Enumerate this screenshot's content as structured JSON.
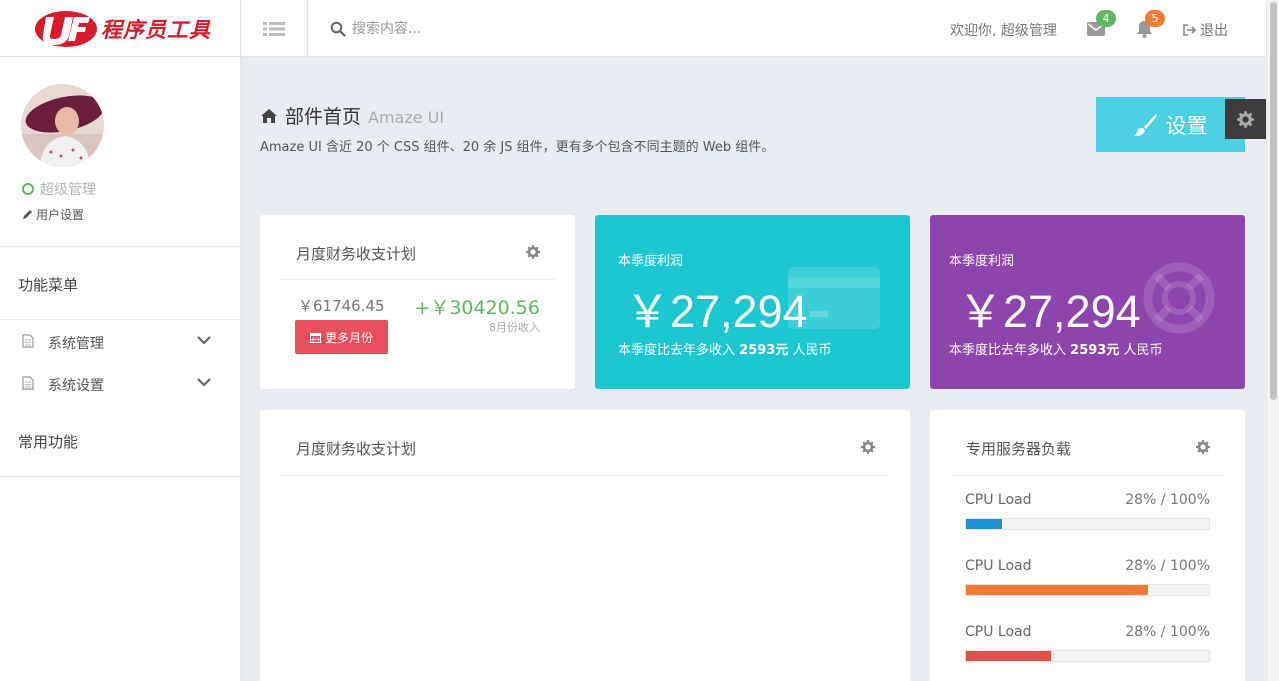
{
  "header": {
    "brand": "程序员工具",
    "search_placeholder": "搜索内容...",
    "welcome": "欢迎你, 超级管理",
    "messages_count": "4",
    "notifications_count": "5",
    "logout_label": "退出"
  },
  "sidebar": {
    "user_role": "超级管理",
    "user_settings": "用户设置",
    "section_menu": "功能菜单",
    "items": [
      {
        "label": "系统管理"
      },
      {
        "label": "系统设置"
      }
    ],
    "section_common": "常用功能"
  },
  "page": {
    "title": "部件首页",
    "subtitle": "Amaze UI",
    "description": "Amaze UI 含近 20 个 CSS 组件、20 余 JS 组件，更有多个包含不同主题的 Web 组件。",
    "settings_button": "设置"
  },
  "finance_card": {
    "title": "月度财务收支计划",
    "left_amount": "￥61746.45",
    "right_amount": "+￥30420.56",
    "right_note": "8月份收入",
    "more_button": "更多月份"
  },
  "profit_cards": [
    {
      "label": "本季度利润",
      "amount": "￥27,294",
      "foot_prefix": "本季度比去年多收入",
      "foot_value": "2593元",
      "foot_suffix": "人民币",
      "color": "#1cc7d0"
    },
    {
      "label": "本季度利润",
      "amount": "￥27,294",
      "foot_prefix": "本季度比去年多收入",
      "foot_value": "2593元",
      "foot_suffix": "人民币",
      "color": "#8e44ad"
    }
  ],
  "chart_card": {
    "title": "月度财务收支计划"
  },
  "server_card": {
    "title": "专用服务器负载",
    "rows": [
      {
        "name": "CPU Load",
        "value": "28% / 100%",
        "fill": 0.15,
        "color": "#1a91d1"
      },
      {
        "name": "CPU Load",
        "value": "28% / 100%",
        "fill": 0.75,
        "color": "#f37b35"
      },
      {
        "name": "CPU Load",
        "value": "28% / 100%",
        "fill": 0.35,
        "color": "#dd514c"
      }
    ]
  },
  "colors": {
    "accent_cyan": "#4dd0e1",
    "success": "#5eb95e",
    "danger": "#e84d5b",
    "badge_green": "#5eb95e",
    "badge_orange": "#f37b35"
  }
}
